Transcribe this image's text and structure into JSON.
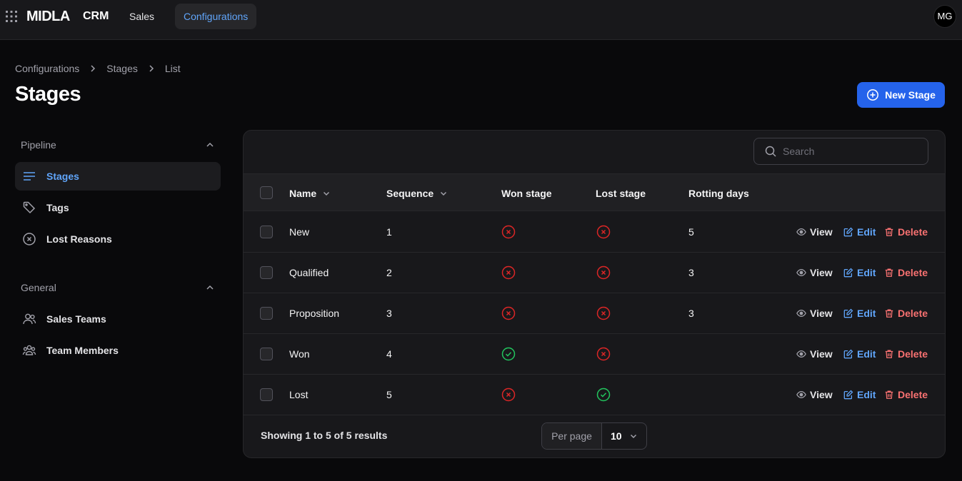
{
  "topbar": {
    "logo": "MIDLA",
    "logo_sub": "CRM",
    "nav": [
      {
        "label": "Sales",
        "active": false
      },
      {
        "label": "Configurations",
        "active": true
      }
    ],
    "avatar_initials": "MG"
  },
  "breadcrumb": [
    "Configurations",
    "Stages",
    "List"
  ],
  "page_title": "Stages",
  "new_button_label": "New Stage",
  "sidebar": {
    "groups": [
      {
        "title": "Pipeline",
        "items": [
          {
            "label": "Stages",
            "icon": "bars-icon",
            "active": true
          },
          {
            "label": "Tags",
            "icon": "tag-icon",
            "active": false
          },
          {
            "label": "Lost Reasons",
            "icon": "x-circle-icon",
            "active": false
          }
        ]
      },
      {
        "title": "General",
        "items": [
          {
            "label": "Sales Teams",
            "icon": "users-icon",
            "active": false
          },
          {
            "label": "Team Members",
            "icon": "user-group-icon",
            "active": false
          }
        ]
      }
    ]
  },
  "table": {
    "search_placeholder": "Search",
    "columns": [
      "Name",
      "Sequence",
      "Won stage",
      "Lost stage",
      "Rotting days"
    ],
    "rows": [
      {
        "name": "New",
        "sequence": "1",
        "won": false,
        "lost": false,
        "rotting_days": "5"
      },
      {
        "name": "Qualified",
        "sequence": "2",
        "won": false,
        "lost": false,
        "rotting_days": "3"
      },
      {
        "name": "Proposition",
        "sequence": "3",
        "won": false,
        "lost": false,
        "rotting_days": "3"
      },
      {
        "name": "Won",
        "sequence": "4",
        "won": true,
        "lost": false,
        "rotting_days": ""
      },
      {
        "name": "Lost",
        "sequence": "5",
        "won": false,
        "lost": true,
        "rotting_days": ""
      }
    ],
    "actions": {
      "view": "View",
      "edit": "Edit",
      "delete": "Delete"
    },
    "footer_text": "Showing 1 to 5 of 5 results",
    "per_page_label": "Per page",
    "per_page_value": "10"
  },
  "colors": {
    "accent": "#2563eb",
    "link": "#60a5fa",
    "danger": "#f87171",
    "success": "#22c55e",
    "fail": "#dc2626"
  }
}
